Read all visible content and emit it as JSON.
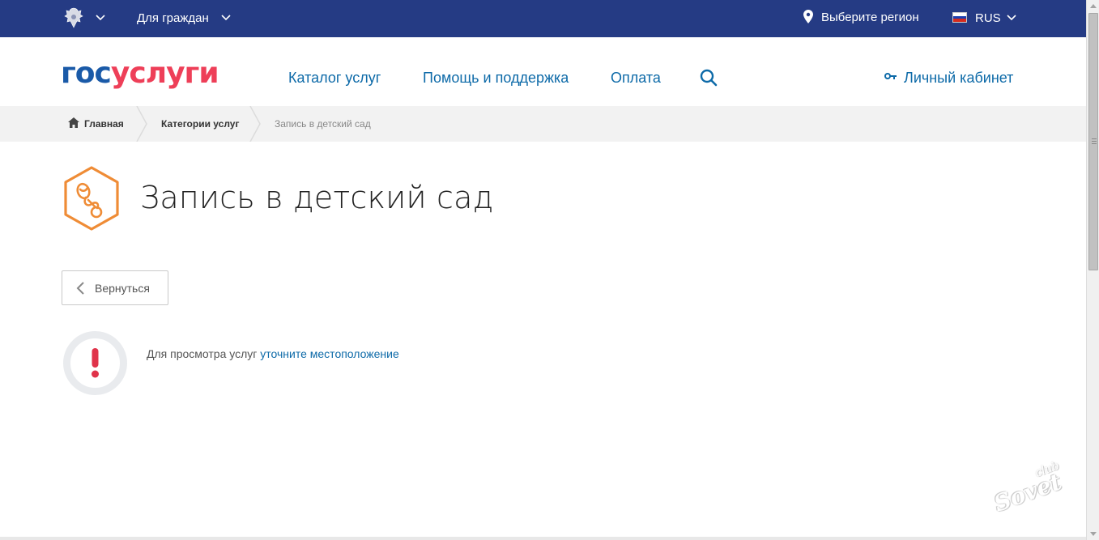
{
  "topbar": {
    "for_citizens": "Для граждан",
    "region": "Выберите регион",
    "language": "RUS"
  },
  "header": {
    "logo_part1": "гос",
    "logo_part2": "услуги",
    "nav": {
      "catalog": "Каталог услуг",
      "help": "Помощь и поддержка",
      "payment": "Оплата"
    },
    "cabinet": "Личный кабинет"
  },
  "breadcrumb": {
    "home": "Главная",
    "categories": "Категории услуг",
    "current": "Запись в детский сад"
  },
  "page": {
    "title": "Запись в детский сад",
    "back_label": "Вернуться",
    "alert_text": "Для просмотра услуг",
    "alert_link": "уточните местоположение"
  },
  "watermark": {
    "small": "club",
    "large": "Sovet"
  },
  "colors": {
    "topbar": "#253b84",
    "link": "#0d6aa8",
    "logo_blue": "#1a5aa8",
    "logo_red": "#ee3f58",
    "service_icon": "#ef8c36",
    "alert_red": "#e0334a"
  }
}
